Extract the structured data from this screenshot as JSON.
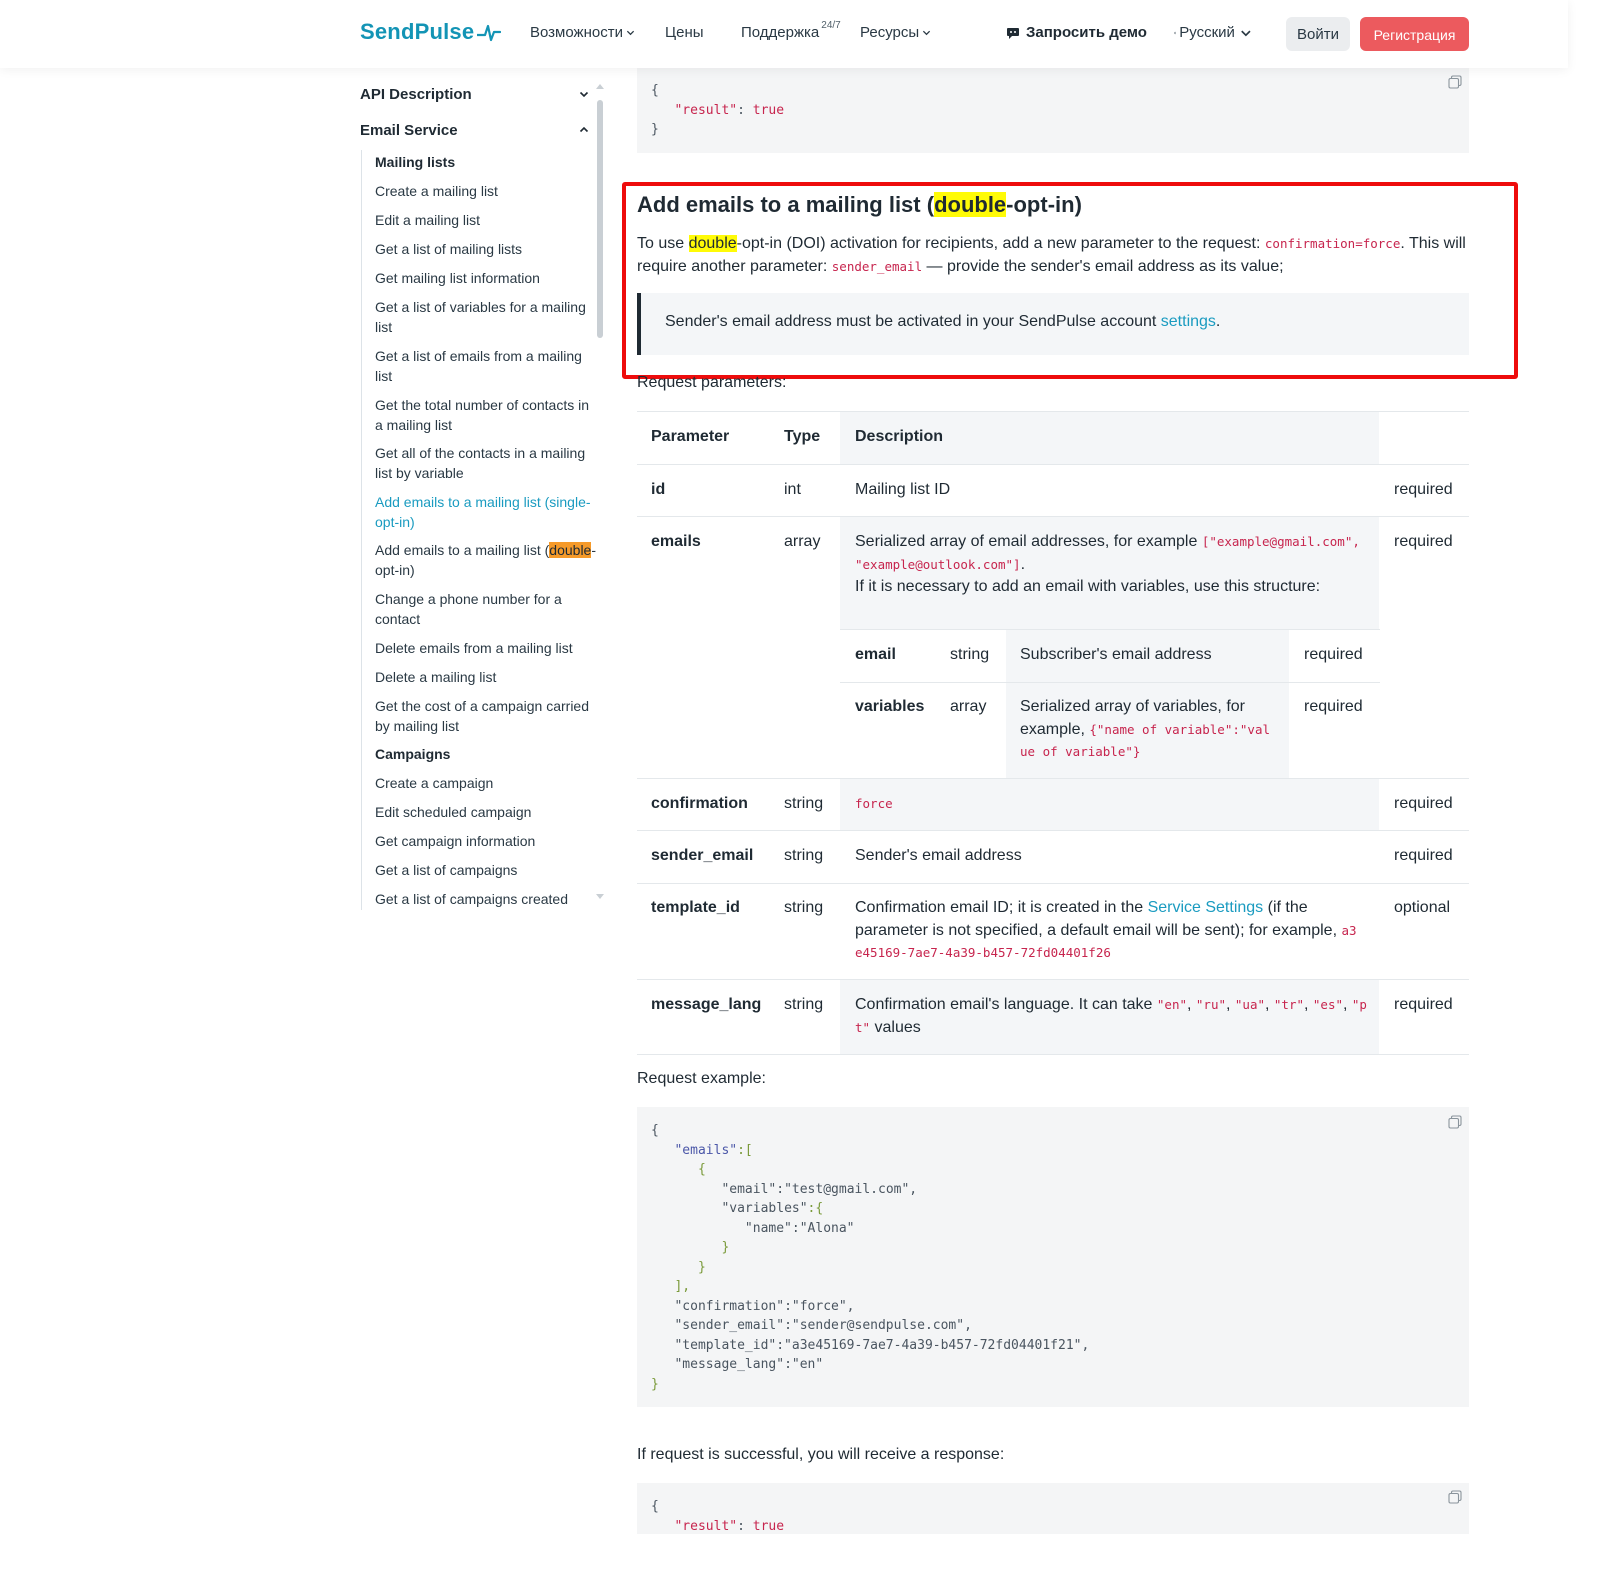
{
  "header": {
    "logo": "SendPulse",
    "nav": [
      {
        "label": "Возможности",
        "has_dropdown": true
      },
      {
        "label": "Цены",
        "has_dropdown": false
      },
      {
        "label": "Поддержка",
        "badge": "24/7",
        "has_dropdown": false
      },
      {
        "label": "Ресурсы",
        "has_dropdown": true
      }
    ],
    "demo_label": "Запросить демо",
    "language": "Русский",
    "login_label": "Войти",
    "register_label": "Регистрация",
    "accent_color": "#1394b5",
    "register_color": "#ec5a5e"
  },
  "sidebar": {
    "sections": [
      {
        "label": "API Description",
        "expanded": false
      },
      {
        "label": "Email Service",
        "expanded": true
      }
    ],
    "items": [
      {
        "label": "Mailing lists"
      },
      {
        "label": "Create a mailing list"
      },
      {
        "label": "Edit a mailing list"
      },
      {
        "label": "Get a list of mailing lists"
      },
      {
        "label": "Get mailing list information"
      },
      {
        "label": "Get a list of variables for a mailing list"
      },
      {
        "label": "Get a list of emails from a mailing list"
      },
      {
        "label": "Get the total number of contacts in a mailing list"
      },
      {
        "label": "Get all of the contacts in a mailing list by variable"
      },
      {
        "label": "Add emails to a mailing list (single-opt-in)"
      },
      {
        "label_pre": "Add emails to a mailing list (",
        "label_hl": "double",
        "label_post": "-opt-in)"
      },
      {
        "label": "Change a phone number for a contact"
      },
      {
        "label": "Delete emails from a mailing list"
      },
      {
        "label": "Delete a mailing list"
      },
      {
        "label": "Get the cost of a campaign carried by mailing list"
      },
      {
        "label": "Campaigns"
      },
      {
        "label": "Create a campaign"
      },
      {
        "label": "Edit scheduled campaign"
      },
      {
        "label": "Get campaign information"
      },
      {
        "label": "Get a list of campaigns"
      },
      {
        "label": "Get a list of campaigns created"
      }
    ]
  },
  "top_response": {
    "open": "{",
    "key": "\"result\"",
    "colon": ": ",
    "value": "true",
    "close": "}"
  },
  "section": {
    "title_pre": "Add emails to a mailing list (",
    "title_hl": "double",
    "title_post": "-opt-in)",
    "intro_1": "To use ",
    "intro_hl": "double",
    "intro_2": "-opt-in (DOI) activation for recipients, add a new parameter to the request: ",
    "intro_code_1": "confirmation=force",
    "intro_3": ". This will require another parameter: ",
    "intro_code_2": "sender_email",
    "intro_4": " — provide the sender's email address as its value;",
    "note_text": "Sender's email address must be activated in your SendPulse account ",
    "note_link": "settings",
    "note_end": "."
  },
  "request_params_label": "Request parameters:",
  "table": {
    "headers": {
      "param": "Parameter",
      "type": "Type",
      "desc": "Description"
    },
    "rows": {
      "id": {
        "param": "id",
        "type": "int",
        "desc": "Mailing list ID",
        "req": "required"
      },
      "emails": {
        "param": "emails",
        "type": "array",
        "desc_1": "Serialized array of email addresses, for example ",
        "code_1": "[\"example@gmail.com\",",
        "code_2": "\"example@outlook.com\"]",
        "desc_dot": ".",
        "desc_2": "If it is necessary to add an email with variables, use this structure:",
        "req": "required",
        "sub": [
          {
            "param": "email",
            "type": "string",
            "desc": "Subscriber's email address",
            "req": "required"
          },
          {
            "param": "variables",
            "type": "array",
            "desc_1": "Serialized array of variables, for",
            "desc_2": "example, ",
            "code_1": "{\"name of variable\":\"val",
            "code_2": "ue of variable\"}",
            "req": "required"
          }
        ]
      },
      "confirmation": {
        "param": "confirmation",
        "type": "string",
        "code": "force",
        "req": "required"
      },
      "sender_email": {
        "param": "sender_email",
        "type": "string",
        "desc": "Sender's email address",
        "req": "required"
      },
      "template_id": {
        "param": "template_id",
        "type": "string",
        "desc_1": "Confirmation email ID; it is created in the ",
        "link": "Service Settings",
        "desc_2": " (if the",
        "desc_3": "parameter is not specified, a default email will be sent); for example, ",
        "code_1": "a3",
        "code_2": "e45169-7ae7-4a39-b457-72fd04401f26",
        "req": "optional"
      },
      "message_lang": {
        "param": "message_lang",
        "type": "string",
        "desc_1": "Confirmation email's language. It can take ",
        "codes": [
          "\"en\"",
          "\"ru\"",
          "\"ua\"",
          "\"tr\"",
          "\"es\"",
          "\"p"
        ],
        "code_cont": "t\"",
        "desc_2": " values",
        "req": "required"
      }
    }
  },
  "request_example_label": "Request example:",
  "request_example": {
    "l1": "{",
    "l2_key": "\"emails\"",
    "l2_rest": ":[",
    "l3": "{",
    "l4_key": "\"email\"",
    "l4_val": ":\"test@gmail.com\",",
    "l5_key": "\"variables\"",
    "l5_rest": ":{",
    "l6_key": "\"name\"",
    "l6_val": ":\"Alona\"",
    "l7": "}",
    "l8": "}",
    "l9": "],",
    "l10_key": "\"confirmation\"",
    "l10_val": ":\"force\",",
    "l11_key": "\"sender_email\"",
    "l11_val": ":\"sender@sendpulse.com\",",
    "l12_key": "\"template_id\"",
    "l12_val": ":\"a3e45169-7ae7-4a39-b457-72fd04401f21\",",
    "l13_key": "\"message_lang\"",
    "l13_val": ":\"en\"",
    "l14": "}"
  },
  "success_label": "If request is successful, you will receive a response:",
  "bottom_response": {
    "open": "{",
    "key": "\"result\"",
    "colon": ": ",
    "value": "true"
  }
}
